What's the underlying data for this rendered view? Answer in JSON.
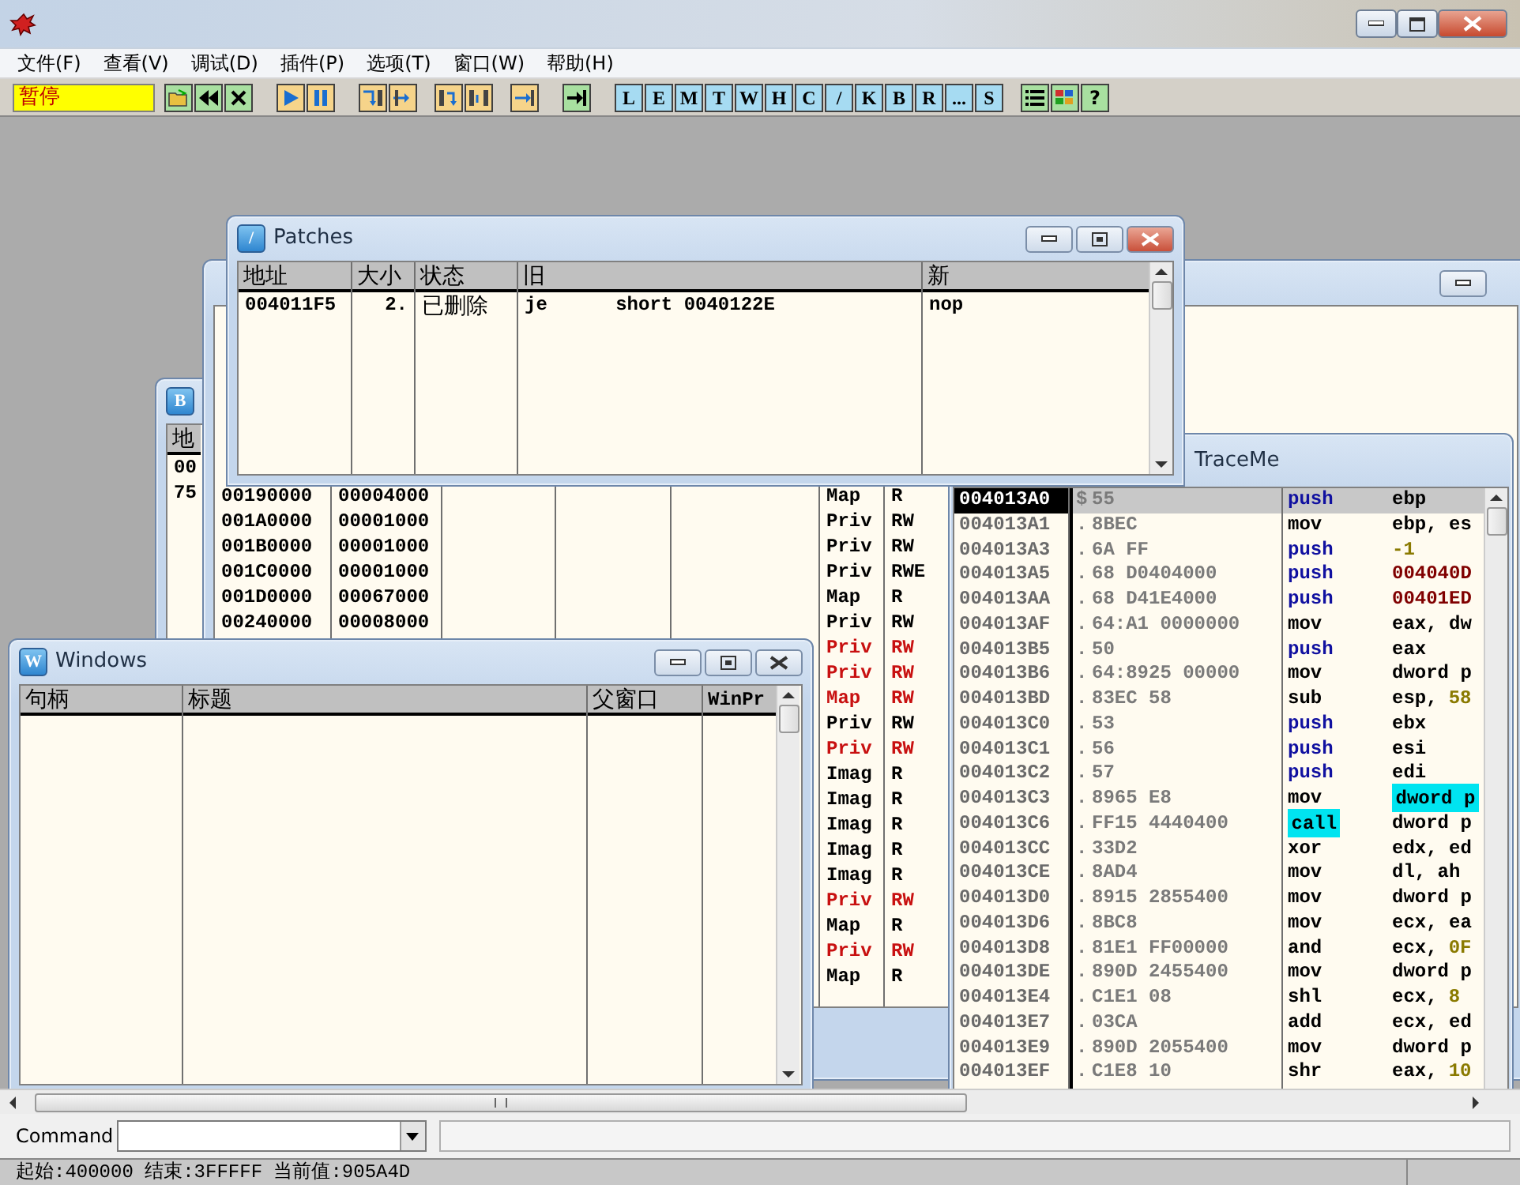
{
  "menu": [
    {
      "label": "文件(F)"
    },
    {
      "label": "查看(V)"
    },
    {
      "label": "调试(D)"
    },
    {
      "label": "插件(P)"
    },
    {
      "label": "选项(T)"
    },
    {
      "label": "窗口(W)"
    },
    {
      "label": "帮助(H)"
    }
  ],
  "toolbar": {
    "status": "暂停",
    "letter_buttons": [
      "L",
      "E",
      "M",
      "T",
      "W",
      "H",
      "C",
      "/",
      "K",
      "B",
      "R",
      "...",
      "S"
    ],
    "help_button": "?"
  },
  "window_b": {
    "icon_letter": "B",
    "columns": [
      "地"
    ],
    "rows": [
      "00",
      "75"
    ]
  },
  "memory_window": {
    "rows": [
      {
        "address": "00190000",
        "size": "00004000",
        "type": "Map",
        "access": "R",
        "highlighted": false
      },
      {
        "address": "001A0000",
        "size": "00001000",
        "type": "Priv",
        "access": "RW",
        "highlighted": false
      },
      {
        "address": "001B0000",
        "size": "00001000",
        "type": "Priv",
        "access": "RW",
        "highlighted": false
      },
      {
        "address": "001C0000",
        "size": "00001000",
        "type": "Priv",
        "access": "RWE",
        "highlighted": false
      },
      {
        "address": "001D0000",
        "size": "00067000",
        "type": "Map",
        "access": "R",
        "highlighted": false
      },
      {
        "address": "00240000",
        "size": "00008000",
        "type": "Priv",
        "access": "RW",
        "highlighted": false
      },
      {
        "type": "Priv",
        "access": "RW",
        "highlighted": true
      },
      {
        "type": "Priv",
        "access": "RW",
        "highlighted": true
      },
      {
        "type": "Map",
        "access": "RW",
        "highlighted": true
      },
      {
        "type": "Priv",
        "access": "RW",
        "highlighted": false
      },
      {
        "type": "Priv",
        "access": "RW",
        "highlighted": true
      },
      {
        "type": "Imag",
        "access": "R",
        "highlighted": false
      },
      {
        "type": "Imag",
        "access": "R",
        "highlighted": false
      },
      {
        "type": "Imag",
        "access": "R",
        "highlighted": false
      },
      {
        "type": "Imag",
        "access": "R",
        "highlighted": false
      },
      {
        "type": "Imag",
        "access": "R",
        "highlighted": false
      },
      {
        "type": "Priv",
        "access": "RW",
        "highlighted": true
      },
      {
        "type": "Map",
        "access": "R",
        "highlighted": false
      },
      {
        "type": "Priv",
        "access": "RW",
        "highlighted": true
      },
      {
        "type": "Map",
        "access": "R",
        "highlighted": false
      }
    ]
  },
  "cpu_window": {
    "title": "TraceMe",
    "rows": [
      {
        "address": "004013A0",
        "flag": "$",
        "hex": "55",
        "mnemonic": "push",
        "kind": "stack",
        "operand": "ebp",
        "selected": true,
        "mnemonic_marked": false,
        "operand_marked": false
      },
      {
        "address": "004013A1",
        "flag": ".",
        "hex": "8BEC",
        "mnemonic": "mov",
        "kind": "plain",
        "operand": "ebp, es",
        "selected": false,
        "mnemonic_marked": false,
        "operand_marked": false
      },
      {
        "address": "004013A3",
        "flag": ".",
        "hex": "6A FF",
        "mnemonic": "push",
        "kind": "stack",
        "immediate": "-1",
        "selected": false,
        "mnemonic_marked": false,
        "operand_marked": false
      },
      {
        "address": "004013A5",
        "flag": ".",
        "hex": "68 D0404000",
        "mnemonic": "push",
        "kind": "stack",
        "target": "004040D",
        "selected": false,
        "mnemonic_marked": false,
        "operand_marked": false
      },
      {
        "address": "004013AA",
        "flag": ".",
        "hex": "68 D41E4000",
        "mnemonic": "push",
        "kind": "stack",
        "target": "00401ED",
        "selected": false,
        "mnemonic_marked": false,
        "operand_marked": false
      },
      {
        "address": "004013AF",
        "flag": ".",
        "hex": "64:A1 0000000",
        "mnemonic": "mov",
        "kind": "plain",
        "operand": "eax, dw",
        "selected": false,
        "mnemonic_marked": false,
        "operand_marked": false
      },
      {
        "address": "004013B5",
        "flag": ".",
        "hex": "50",
        "mnemonic": "push",
        "kind": "stack",
        "operand": "eax",
        "selected": false,
        "mnemonic_marked": false,
        "operand_marked": false
      },
      {
        "address": "004013B6",
        "flag": ".",
        "hex": "64:8925 00000",
        "mnemonic": "mov",
        "kind": "plain",
        "operand": "dword p",
        "selected": false,
        "mnemonic_marked": false,
        "operand_marked": false
      },
      {
        "address": "004013BD",
        "flag": ".",
        "hex": "83EC 58",
        "mnemonic": "sub",
        "kind": "plain",
        "operand": "esp,",
        "immediate": "58",
        "selected": false,
        "mnemonic_marked": false,
        "operand_marked": false
      },
      {
        "address": "004013C0",
        "flag": ".",
        "hex": "53",
        "mnemonic": "push",
        "kind": "stack",
        "operand": "ebx",
        "selected": false,
        "mnemonic_marked": false,
        "operand_marked": false
      },
      {
        "address": "004013C1",
        "flag": ".",
        "hex": "56",
        "mnemonic": "push",
        "kind": "stack",
        "operand": "esi",
        "selected": false,
        "mnemonic_marked": false,
        "operand_marked": false
      },
      {
        "address": "004013C2",
        "flag": ".",
        "hex": "57",
        "mnemonic": "push",
        "kind": "stack",
        "operand": "edi",
        "selected": false,
        "mnemonic_marked": false,
        "operand_marked": false
      },
      {
        "address": "004013C3",
        "flag": ".",
        "hex": "8965 E8",
        "mnemonic": "mov",
        "kind": "plain",
        "operand": "dword p",
        "selected": false,
        "mnemonic_marked": false,
        "operand_marked": true
      },
      {
        "address": "004013C6",
        "flag": ".",
        "hex": "FF15 4440400",
        "mnemonic": "call",
        "kind": "plain",
        "operand": "dword p",
        "selected": false,
        "mnemonic_marked": true,
        "operand_marked": false
      },
      {
        "address": "004013CC",
        "flag": ".",
        "hex": "33D2",
        "mnemonic": "xor",
        "kind": "plain",
        "operand": "edx, ed",
        "selected": false,
        "mnemonic_marked": false,
        "operand_marked": false
      },
      {
        "address": "004013CE",
        "flag": ".",
        "hex": "8AD4",
        "mnemonic": "mov",
        "kind": "plain",
        "operand": "dl, ah",
        "selected": false,
        "mnemonic_marked": false,
        "operand_marked": false
      },
      {
        "address": "004013D0",
        "flag": ".",
        "hex": "8915 2855400",
        "mnemonic": "mov",
        "kind": "plain",
        "operand": "dword p",
        "selected": false,
        "mnemonic_marked": false,
        "operand_marked": false
      },
      {
        "address": "004013D6",
        "flag": ".",
        "hex": "8BC8",
        "mnemonic": "mov",
        "kind": "plain",
        "operand": "ecx, ea",
        "selected": false,
        "mnemonic_marked": false,
        "operand_marked": false
      },
      {
        "address": "004013D8",
        "flag": ".",
        "hex": "81E1 FF00000",
        "mnemonic": "and",
        "kind": "plain",
        "operand": "ecx,",
        "immediate": "0F",
        "selected": false,
        "mnemonic_marked": false,
        "operand_marked": false
      },
      {
        "address": "004013DE",
        "flag": ".",
        "hex": "890D 2455400",
        "mnemonic": "mov",
        "kind": "plain",
        "operand": "dword p",
        "selected": false,
        "mnemonic_marked": false,
        "operand_marked": false
      },
      {
        "address": "004013E4",
        "flag": ".",
        "hex": "C1E1 08",
        "mnemonic": "shl",
        "kind": "plain",
        "operand": "ecx,",
        "immediate": "8",
        "selected": false,
        "mnemonic_marked": false,
        "operand_marked": false
      },
      {
        "address": "004013E7",
        "flag": ".",
        "hex": "03CA",
        "mnemonic": "add",
        "kind": "plain",
        "operand": "ecx, ed",
        "selected": false,
        "mnemonic_marked": false,
        "operand_marked": false
      },
      {
        "address": "004013E9",
        "flag": ".",
        "hex": "890D 2055400",
        "mnemonic": "mov",
        "kind": "plain",
        "operand": "dword p",
        "selected": false,
        "mnemonic_marked": false,
        "operand_marked": false
      },
      {
        "address": "004013EF",
        "flag": ".",
        "hex": "C1E8 10",
        "mnemonic": "shr",
        "kind": "plain",
        "operand": "eax,",
        "immediate": "10",
        "selected": false,
        "mnemonic_marked": false,
        "operand_marked": false
      }
    ]
  },
  "windows_window": {
    "icon_letter": "W",
    "title": "Windows",
    "columns": [
      "句柄",
      "标题",
      "父窗口",
      "WinPr"
    ]
  },
  "patches_window": {
    "icon_letter": "/",
    "title": "Patches",
    "columns": [
      "地址",
      "大小",
      "状态",
      "旧",
      "新"
    ],
    "rows": [
      {
        "address": "004011F5",
        "size": "2.",
        "state": "已删除",
        "old": "je      short 0040122E",
        "new": "nop"
      }
    ]
  },
  "command_bar": {
    "label": "Command"
  },
  "status_bar": "起始:400000 结束:3FFFFF 当前值:905A4D"
}
